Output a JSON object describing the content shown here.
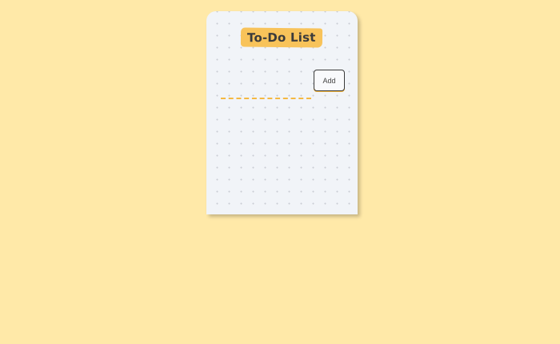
{
  "app": {
    "title": "To-Do List"
  },
  "form": {
    "input_value": "",
    "input_placeholder": "",
    "add_label": "Add"
  },
  "tasks": [],
  "colors": {
    "background": "#ffe9a8",
    "card": "#f1f4f8",
    "accent": "#f8c35a",
    "input_underline": "#f5b942",
    "button_border": "#3a3a3a"
  }
}
